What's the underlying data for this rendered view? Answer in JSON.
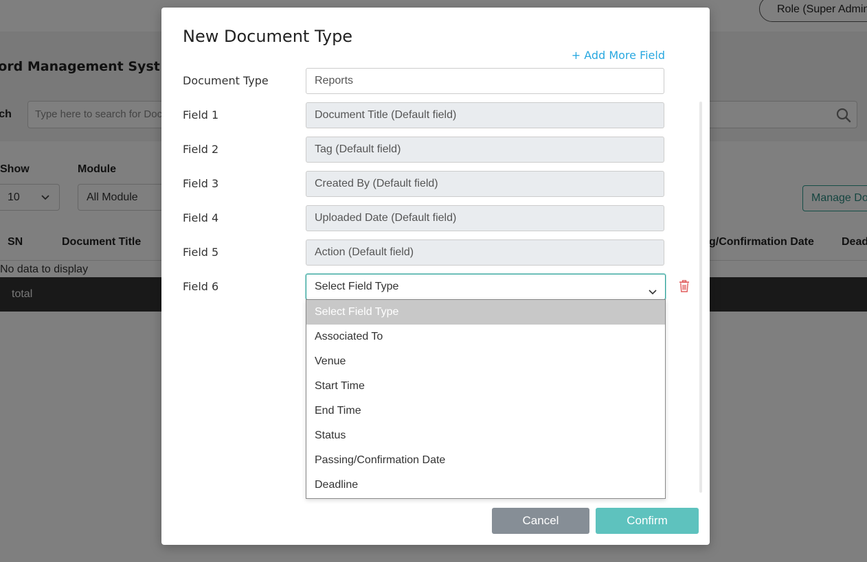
{
  "background": {
    "role_button": "Role (Super Admin",
    "page_title": "cord Management Syst",
    "search_label": "rch",
    "search_placeholder": "Type here to search for Doc",
    "show_label": "Show",
    "show_value": "10",
    "module_label": "Module",
    "module_value": "All Module",
    "manage_button": "Manage Do",
    "columns": [
      "SN",
      "Document Title",
      "g/Confirmation Date",
      "Dead"
    ],
    "empty_message": "No data to display",
    "footer_total": "total"
  },
  "modal": {
    "title": "New Document Type",
    "add_more_link": "+ Add More Field",
    "document_type_label": "Document Type",
    "document_type_value": "Reports",
    "fields": [
      {
        "label": "Field 1",
        "value": "Document Title (Default field)"
      },
      {
        "label": "Field 2",
        "value": "Tag (Default field)"
      },
      {
        "label": "Field 3",
        "value": "Created By (Default field)"
      },
      {
        "label": "Field 4",
        "value": "Uploaded Date (Default field)"
      },
      {
        "label": "Field 5",
        "value": "Action (Default field)"
      }
    ],
    "field6_label": "Field 6",
    "field6_selected": "Select Field Type",
    "dropdown_options": [
      "Select Field Type",
      "Associated To",
      "Venue",
      "Start Time",
      "End Time",
      "Status",
      "Passing/Confirmation Date",
      "Deadline"
    ],
    "cancel_label": "Cancel",
    "confirm_label": "Confirm"
  },
  "colors": {
    "accent": "#29a8e0",
    "confirm": "#5ec2be",
    "cancel": "#868e96",
    "delete": "#e05a5a"
  },
  "icons": [
    "search-icon",
    "chevron-down-icon",
    "trash-icon"
  ]
}
